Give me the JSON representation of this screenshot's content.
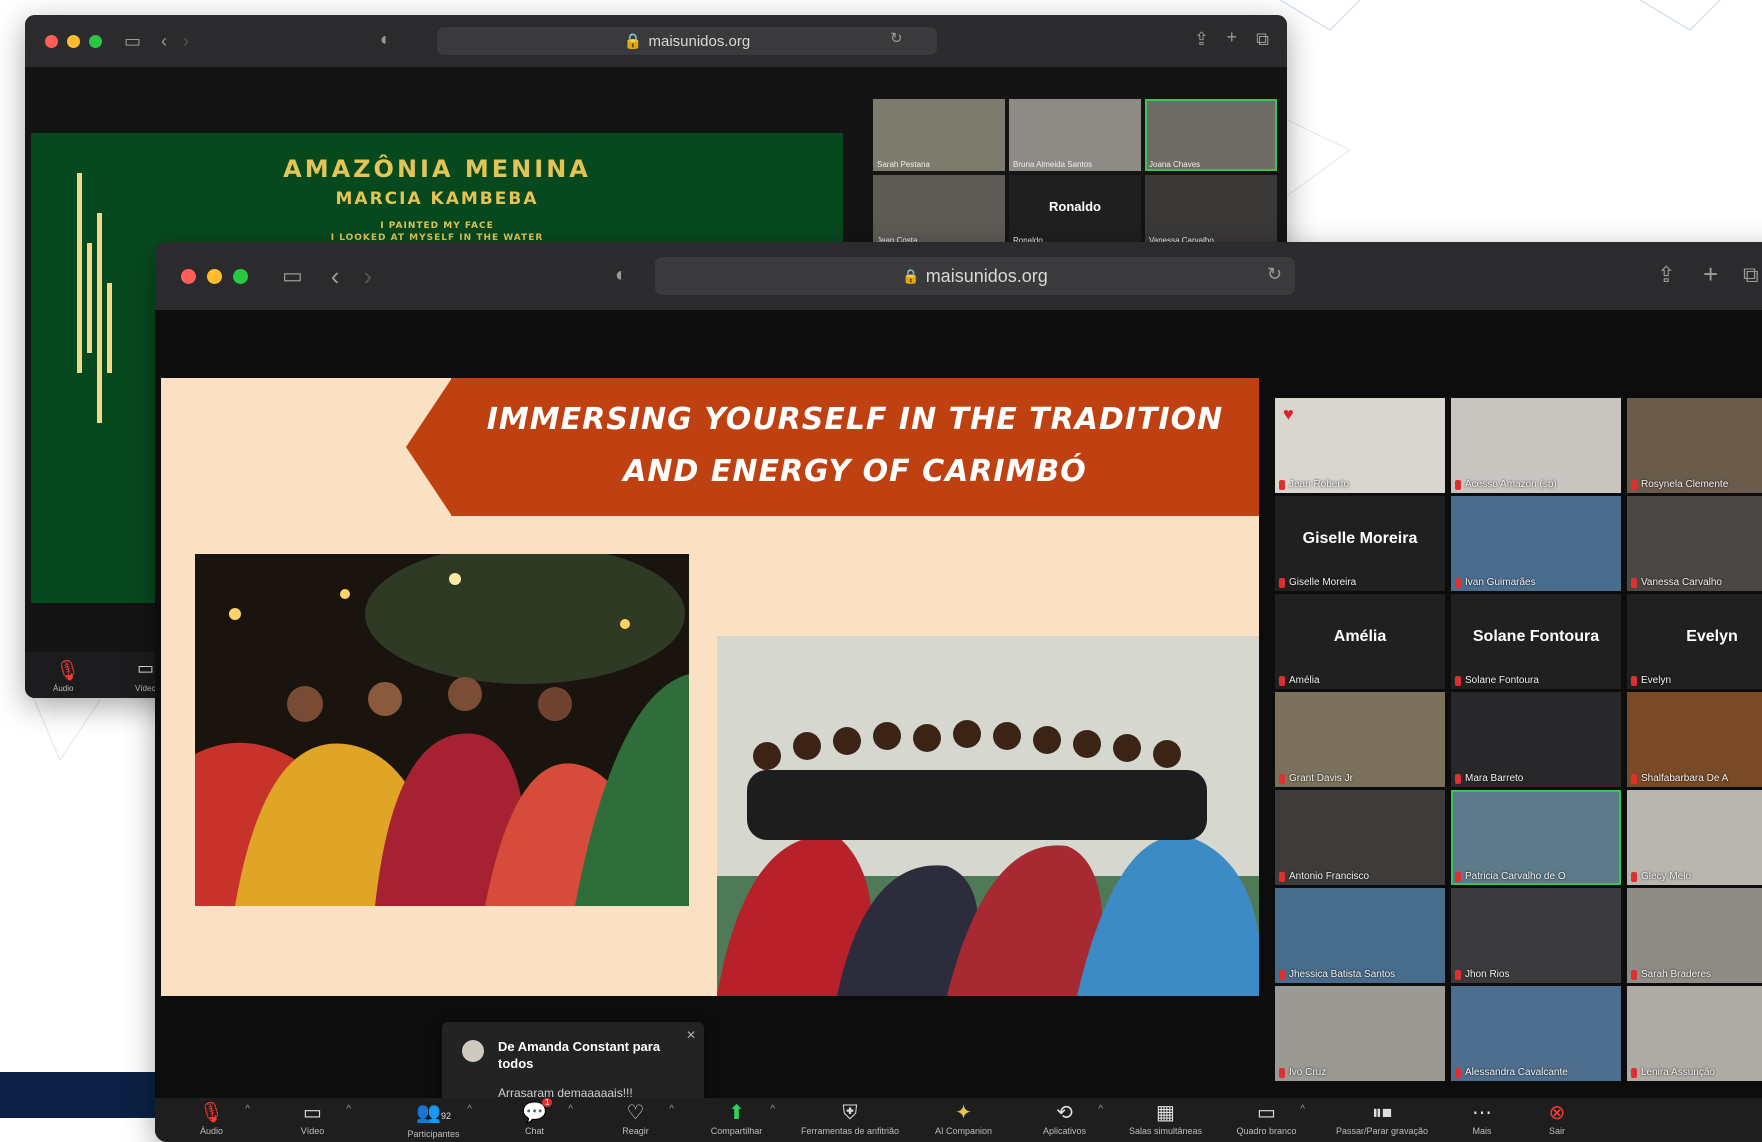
{
  "colors": {
    "accent_green": "#35c759",
    "banner": "#bf4010",
    "slide_bg": "#fbe1c4",
    "back_slide_bg": "#07491f",
    "mic_muted": "#e0302d"
  },
  "back_window": {
    "url": "maisunidos.org",
    "slide": {
      "title": "AMAZÔNIA MENINA",
      "subtitle": "MARCIA KAMBEBA",
      "line1": "I PAINTED MY FACE",
      "line2": "I LOOKED AT MYSELF IN THE WATER"
    },
    "participants": [
      "Sarah Pestana",
      "Bruna Almeida Santos",
      "Joana Chaves",
      "Jean Costa",
      "Ronaldo",
      "Vanessa Carvalho"
    ],
    "ronaldo_big": "Ronaldo",
    "toolbar": {
      "audio": "Áudio",
      "video": "Vídeo"
    }
  },
  "front_window": {
    "url": "maisunidos.org",
    "slide": {
      "title_line1": "IMMERSING YOURSELF IN THE TRADITION",
      "title_line2": "AND ENERGY OF CARIMBÓ"
    },
    "gallery": {
      "row1": [
        "Jean Roberto",
        "Acesso Amazon (sp)",
        "Rosynela Clemente"
      ],
      "row2_big": "Giselle Moreira",
      "row2": [
        "Giselle Moreira",
        "Ivan Guimarães",
        "Vanessa Carvalho"
      ],
      "row3_big": [
        "Amélia",
        "Solane Fontoura",
        "Evelyn"
      ],
      "row3": [
        "Amélia",
        "Solane Fontoura",
        "Evelyn"
      ],
      "row4": [
        "Grant Davis Jr",
        "Mara Barreto",
        "Shalfabarbara De A"
      ],
      "row5": [
        "Antonio Francisco",
        "Patricia Carvalho de O",
        "Glecy Melo"
      ],
      "row6": [
        "Jhessica Batista Santos",
        "Jhon Rios",
        "Sarah Braderes"
      ],
      "row7": [
        "Ivo Cruz",
        "Alessandra Cavalcante",
        "Lenira Assunção"
      ]
    },
    "chat": {
      "from": "De Amanda Constant para todos",
      "message": "Arrasaram demaaaaais!!!"
    },
    "toolbar": {
      "audio": "Áudio",
      "video": "Vídeo",
      "participants": "Participantes",
      "participants_count": "92",
      "chat": "Chat",
      "chat_badge": "1",
      "react": "Reagir",
      "share": "Compartilhar",
      "security": "Ferramentas de anfitrião",
      "ai": "AI Companion",
      "apps": "Aplicativos",
      "rooms": "Salas simultâneas",
      "whiteboard": "Quadro branco",
      "captions": "Passar/Parar gravação",
      "more": "Mais",
      "leave": "Sair"
    }
  }
}
